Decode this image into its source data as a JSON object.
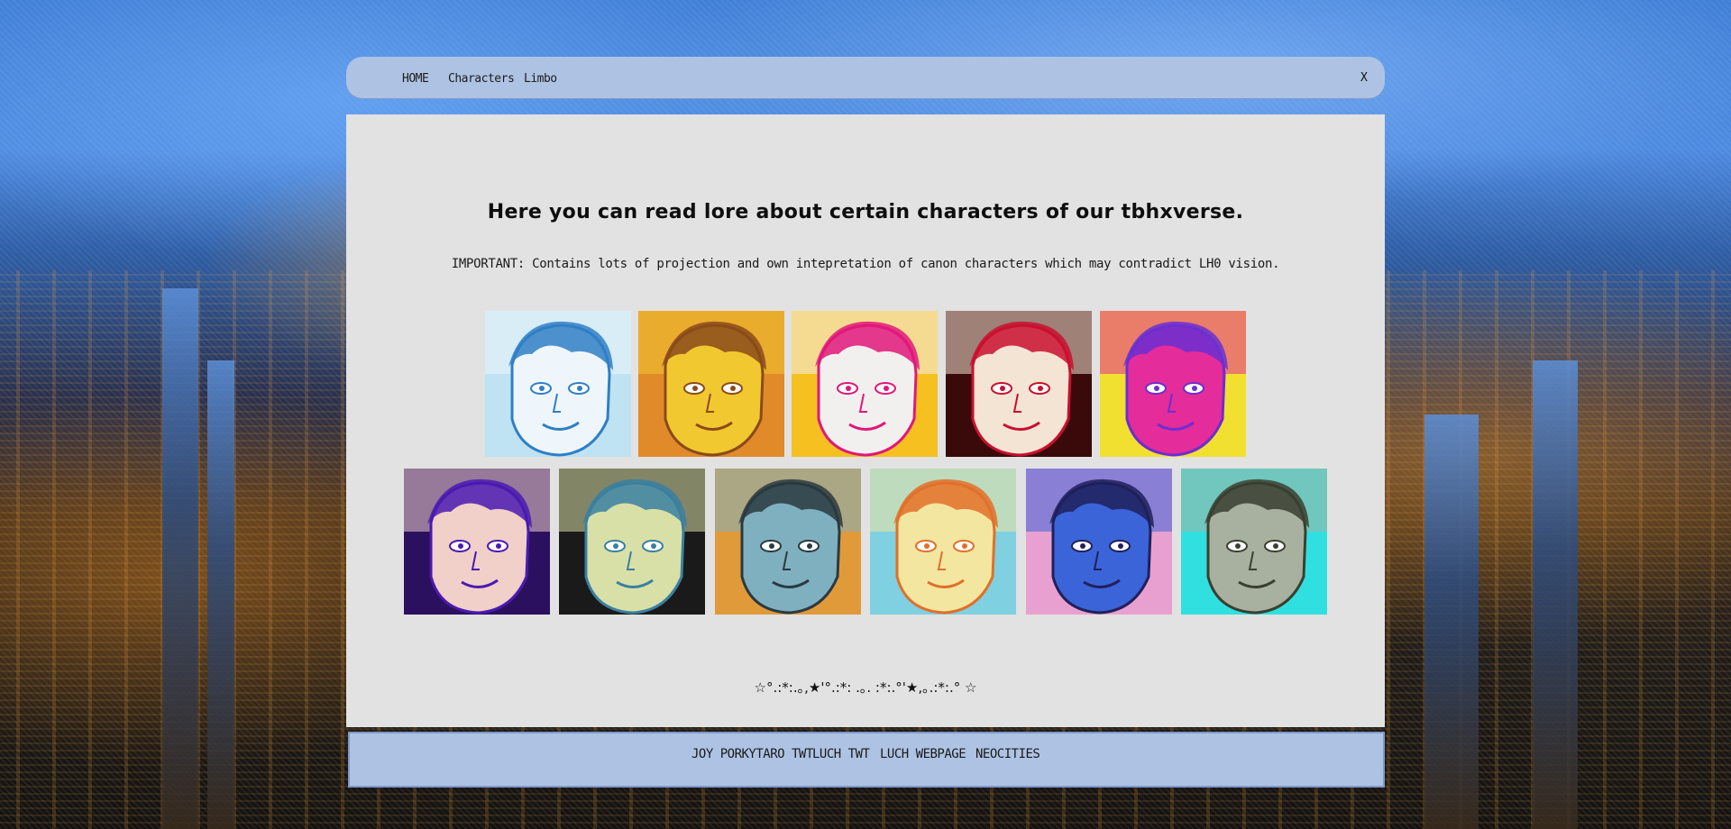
{
  "nav": {
    "home": "HOME",
    "characters": "Characters",
    "limbo": "Limbo",
    "close": "X"
  },
  "main": {
    "title": "Here you can read lore about certain characters of our tbhxverse.",
    "notice": "IMPORTANT: Contains lots of projection and own intepretation of canon characters which may contradict LH0 vision.",
    "sparkles": "☆°.:*:.｡,★'°.:*: .｡. :*:.°'★,｡.:*:.° ☆"
  },
  "portraits": [
    {
      "palette": [
        "#eef6fb",
        "#2f7fc6",
        "#bfe3f2"
      ]
    },
    {
      "palette": [
        "#f2c830",
        "#8a4a1a",
        "#e08a2a"
      ]
    },
    {
      "palette": [
        "#f2f0ee",
        "#e0187a",
        "#f5c020"
      ]
    },
    {
      "palette": [
        "#f3e4d4",
        "#c8102e",
        "#3a0a0a"
      ]
    },
    {
      "palette": [
        "#e42c9a",
        "#6b2fd0",
        "#f2e030"
      ]
    },
    {
      "palette": [
        "#f0d0c8",
        "#4a1ab0",
        "#2b1060"
      ]
    },
    {
      "palette": [
        "#d8e0a8",
        "#3b7fa0",
        "#1a1a1a"
      ]
    },
    {
      "palette": [
        "#7fb0c0",
        "#2a3a40",
        "#e09a3a"
      ]
    },
    {
      "palette": [
        "#f3e6a0",
        "#e0702a",
        "#7fd0e0"
      ]
    },
    {
      "palette": [
        "#3a64d8",
        "#20205a",
        "#e8a0d0"
      ]
    },
    {
      "palette": [
        "#a8b0a0",
        "#3a4030",
        "#30e0e0"
      ]
    }
  ],
  "footer": {
    "link1": "JOY PORKYTARO TWT",
    "link2": "LUCH TWT",
    "link3": "LUCH WEBPAGE",
    "link4": "NEOCITIES"
  }
}
